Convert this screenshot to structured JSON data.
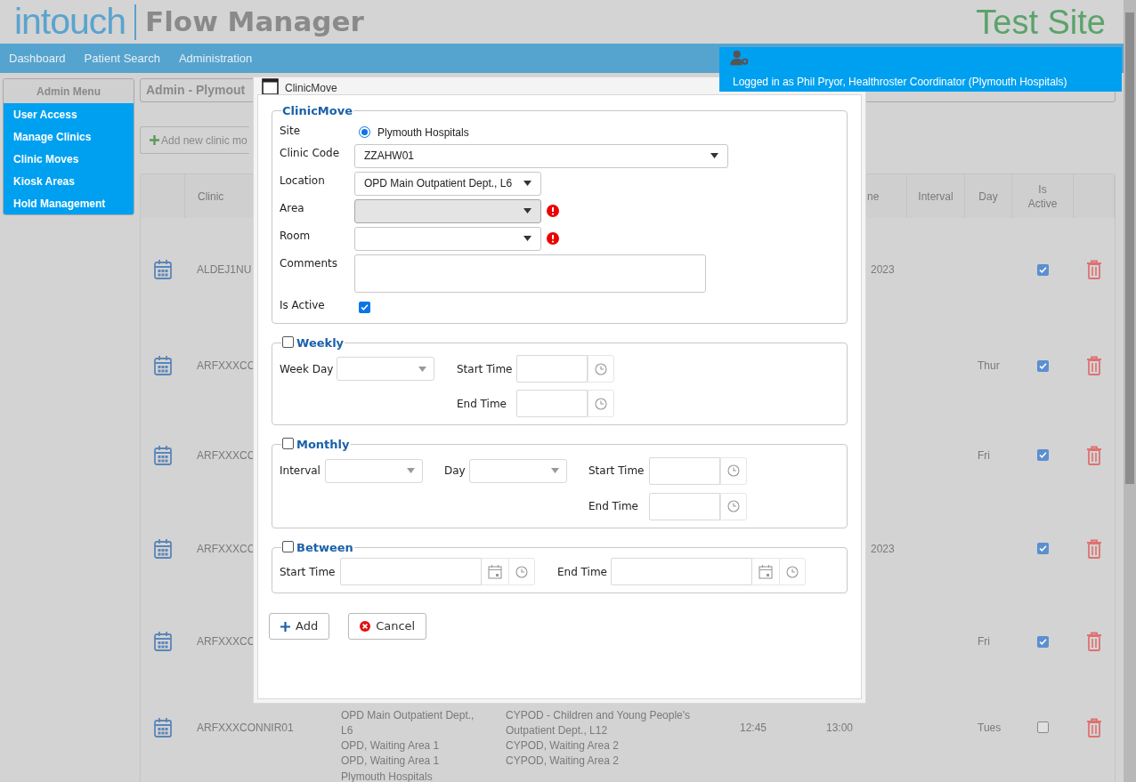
{
  "header": {
    "logo": "intouch",
    "product": "Flow Manager",
    "site_label": "Test Site"
  },
  "nav": [
    {
      "label": "Dashboard"
    },
    {
      "label": "Patient Search"
    },
    {
      "label": "Administration"
    }
  ],
  "user_panel": {
    "text": "Logged in as Phil Pryor, Healthroster Coordinator (Plymouth Hospitals)"
  },
  "admin_menu": {
    "title": "Admin Menu",
    "items": [
      "User Access",
      "Manage Clinics",
      "Clinic Moves",
      "Kiosk Areas",
      "Hold Management"
    ]
  },
  "page_title": "Admin - Plymout",
  "add_button": {
    "label": "Add new clinic mo"
  },
  "table": {
    "columns": {
      "clinic": "Clinic",
      "column_6": "ne",
      "interval": "Interval",
      "day": "Day",
      "is_active": "Is Active"
    },
    "rows": [
      {
        "clinic": "ALDEJ1NU",
        "column_6": "2023",
        "active": true
      },
      {
        "clinic": "ARFXXXCC",
        "day": "Thur",
        "active": true
      },
      {
        "clinic": "ARFXXXCC",
        "day": "Fri",
        "active": true
      },
      {
        "clinic": "ARFXXXCC",
        "column_6": "2023",
        "active": true
      },
      {
        "clinic": "ARFXXXCC",
        "day": "Fri",
        "active": true
      },
      {
        "clinic": "ARFXXXCONNIR01",
        "column_3": [
          "OPD Main Outpatient Dept., L6",
          "OPD, Waiting Area 1",
          "OPD, Waiting Area 1"
        ],
        "column_4": [
          "CYPOD - Children and Young People's Outpatient Dept., L12",
          "CYPOD, Waiting Area 2",
          "CYPOD, Waiting Area 2"
        ],
        "column_5": "12:45",
        "column_6": "13:00",
        "day": "Tues",
        "active": false
      },
      {
        "column_3": [
          "Plymouth Hospitals"
        ]
      }
    ]
  },
  "dialog": {
    "title": "ClinicMove",
    "main": {
      "legend": "ClinicMove",
      "site": {
        "label": "Site",
        "option": "Plymouth Hospitals",
        "selected": true
      },
      "clinic_code": {
        "label": "Clinic Code",
        "value": "ZZAHW01"
      },
      "location": {
        "label": "Location",
        "value": "OPD Main Outpatient Dept., L6"
      },
      "area": {
        "label": "Area",
        "disabled": true,
        "error": true
      },
      "room": {
        "label": "Room",
        "disabled": false,
        "error": true
      },
      "comments": {
        "label": "Comments"
      },
      "is_active": {
        "label": "Is Active",
        "checked": true
      }
    },
    "weekly": {
      "label": "Weekly",
      "checked": false,
      "week_day_label": "Week Day",
      "start_label": "Start Time",
      "end_label": "End Time"
    },
    "monthly": {
      "label": "Monthly",
      "checked": false,
      "interval_label": "Interval",
      "day_label": "Day",
      "start_label": "Start Time",
      "end_label": "End Time"
    },
    "between": {
      "label": "Between",
      "checked": false,
      "start_label": "Start Time",
      "end_label": "End Time"
    },
    "buttons": [
      {
        "kind": "add",
        "label": "Add"
      },
      {
        "kind": "cancel",
        "label": "Cancel"
      }
    ]
  }
}
